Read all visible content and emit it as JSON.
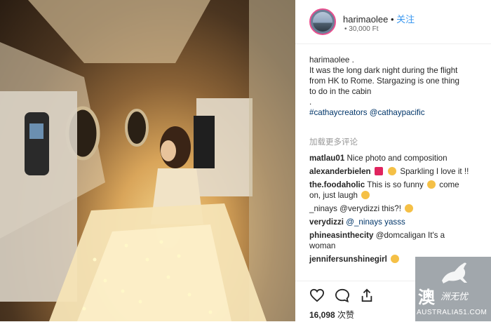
{
  "post": {
    "username": "harimaolee",
    "separator": "•",
    "follow_label": "关注",
    "subtitle": "• 30,000 Ft",
    "caption_lines": [
      "harimaolee .",
      "It was the long dark night during the flight",
      "from HK to Rome. Stargazing is one thing",
      "to do in the cabin",
      "."
    ],
    "hashtags": "#cathaycreators @cathaypacific",
    "load_more": "加载更多评论",
    "comments": [
      {
        "user": "matlau01",
        "text": "Nice photo and composition"
      },
      {
        "user": "alexanderbielen",
        "text": "Sparkling I love it !!"
      },
      {
        "user": "the.foodaholic",
        "text": "This is so funny",
        "text2": "come"
      },
      {
        "user": "",
        "text": "on, just laugh"
      },
      {
        "user": "",
        "text": "_ninays @verydizzi this?!"
      },
      {
        "user": "verydizzi",
        "text": "@_ninays yasss"
      },
      {
        "user": "phineasinthecity",
        "text": "@domcaligan It's a"
      },
      {
        "user": "",
        "text": "woman"
      },
      {
        "user": "jennifersunshinegirl",
        "text": ""
      }
    ],
    "likes_count": "16,098",
    "likes_label": "次赞"
  },
  "watermark": {
    "big": "澳",
    "small": "洲无忧",
    "url": "AUSTRALIA51.COM"
  },
  "icons": [
    "heart-icon",
    "comment-icon",
    "share-icon"
  ],
  "colors": {
    "link": "#3897f0",
    "mention": "#003569",
    "avatar_ring": "#e8508f"
  }
}
